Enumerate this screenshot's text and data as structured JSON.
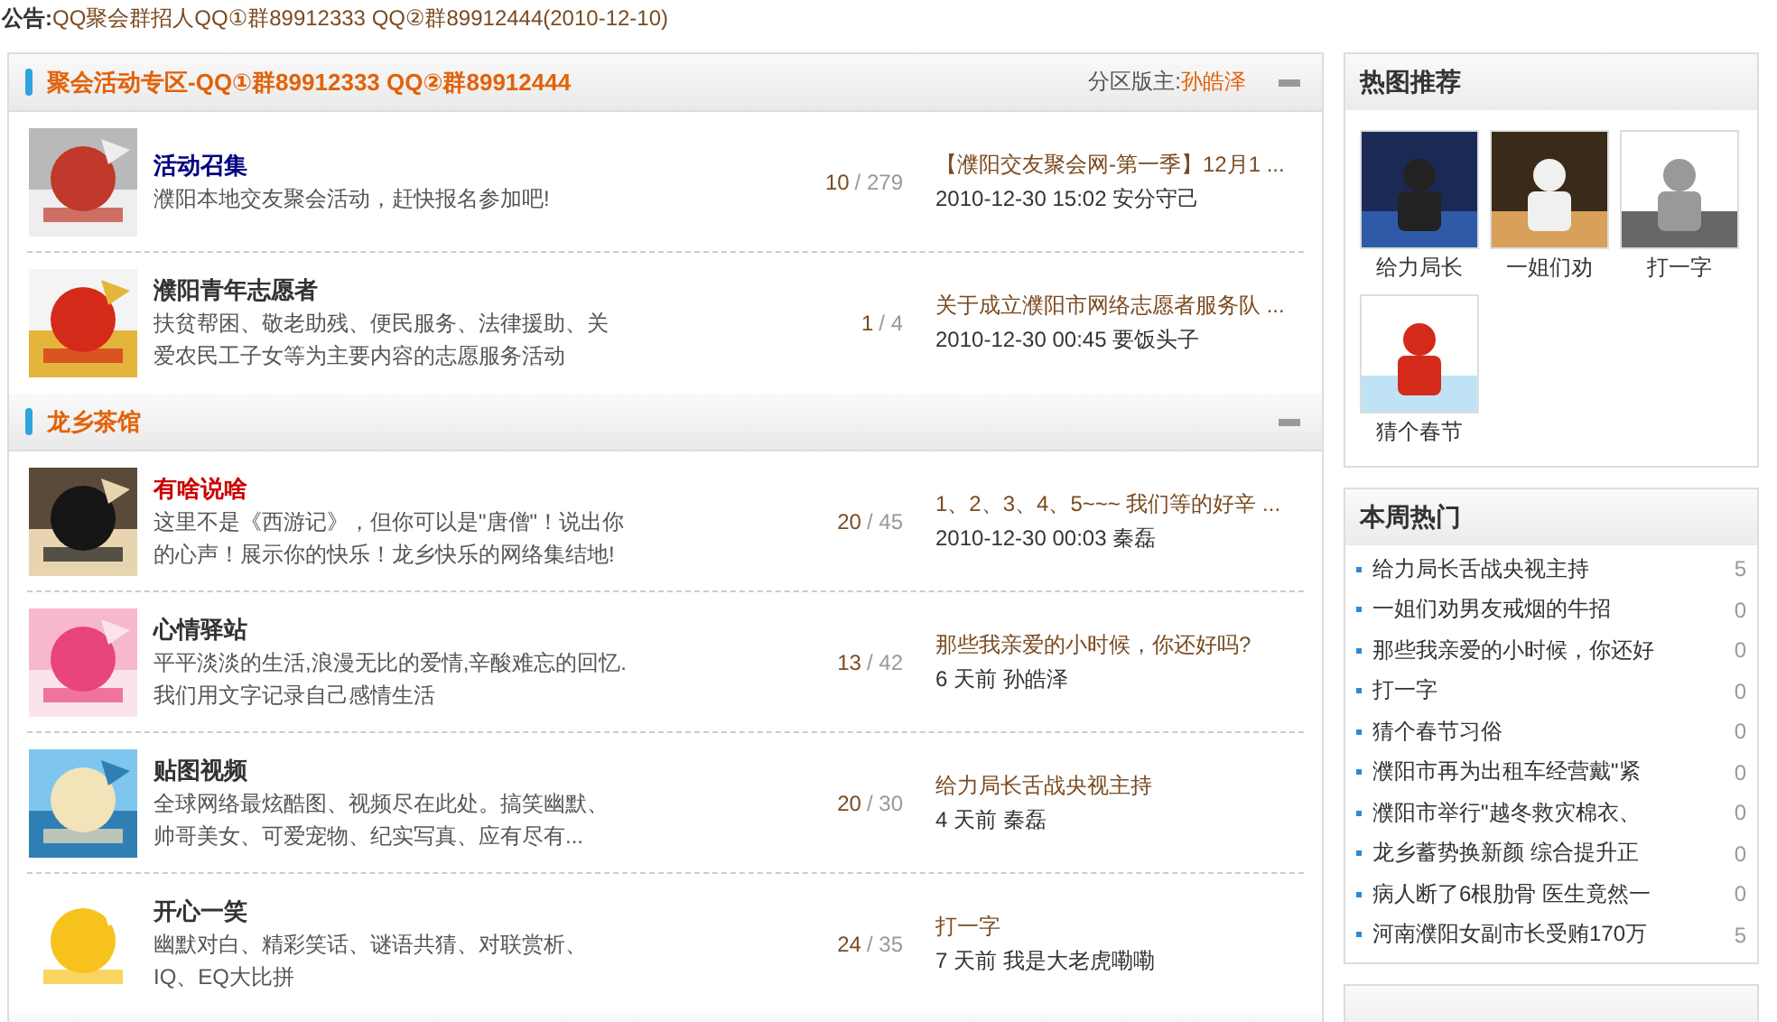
{
  "announcement": {
    "label": "公告:",
    "text": "QQ聚会群招人QQ①群89912333 QQ②群89912444(2010-12-10)"
  },
  "sections": [
    {
      "title": "聚会活动专区-QQ①群89912333 QQ②群89912444",
      "moderator_label": "分区版主:",
      "moderator": "孙皓泽",
      "forums": [
        {
          "name": "活动召集",
          "color": "#000080",
          "description": "濮阳本地交友聚会活动，赶快报名参加吧!",
          "topics": "10",
          "posts": "/ 279",
          "last_title": "【濮阳交友聚会网-第一季】12月1 ...",
          "last_meta": "2010-12-30 15:02 安分守己"
        },
        {
          "name": "濮阳青年志愿者",
          "color": "#333333",
          "description": "扶贫帮困、敬老助残、便民服务、法律援助、关爱农民工子女等为主要内容的志愿服务活动",
          "topics": "1",
          "posts": "/ 4",
          "last_title": "关于成立濮阳市网络志愿者服务队 ...",
          "last_meta": "2010-12-30 00:45 要饭头子"
        }
      ]
    },
    {
      "title": "龙乡茶馆",
      "forums": [
        {
          "name": "有啥说啥",
          "color": "#cc0000",
          "description": "这里不是《西游记》，但你可以是\"唐僧\"！说出你的心声！展示你的快乐！龙乡快乐的网络集结地!",
          "topics": "20",
          "posts": "/ 45",
          "last_title": "1、2、3、4、5~~~ 我们等的好辛 ...",
          "last_meta": "2010-12-30 00:03 秦磊"
        },
        {
          "name": "心情驿站",
          "color": "#333333",
          "description": "平平淡淡的生活,浪漫无比的爱情,辛酸难忘的回忆.我们用文字记录自己感情生活",
          "topics": "13",
          "posts": "/ 42",
          "last_title": "那些我亲爱的小时候，你还好吗?",
          "last_meta": "6 天前 孙皓泽"
        },
        {
          "name": "贴图视频",
          "color": "#333333",
          "description": "全球网络最炫酷图、视频尽在此处。搞笑幽默、帅哥美女、可爱宠物、纪实写真、应有尽有...",
          "topics": "20",
          "posts": "/ 30",
          "last_title": "给力局长舌战央视主持",
          "last_meta": "4 天前 秦磊"
        },
        {
          "name": "开心一笑",
          "color": "#333333",
          "description": "幽默对白、精彩笑话、谜语共猜、对联赏析、IQ、EQ大比拼",
          "topics": "24",
          "posts": "/ 35",
          "last_title": "打一字",
          "last_meta": "7 天前 我是大老虎嘞嘞"
        }
      ]
    }
  ],
  "hot_pictures": {
    "title": "热图推荐",
    "items": [
      {
        "caption": "给力局长"
      },
      {
        "caption": "一姐们劝"
      },
      {
        "caption": "打一字"
      },
      {
        "caption": "猜个春节"
      }
    ]
  },
  "weekly_hot": {
    "title": "本周热门",
    "items": [
      {
        "text": "给力局长舌战央视主持",
        "count": "5"
      },
      {
        "text": "一姐们劝男友戒烟的牛招",
        "count": "0"
      },
      {
        "text": "那些我亲爱的小时候，你还好",
        "count": "0"
      },
      {
        "text": "打一字",
        "count": "0"
      },
      {
        "text": "猜个春节习俗",
        "count": "0"
      },
      {
        "text": "濮阳市再为出租车经营戴\"紧",
        "count": "0"
      },
      {
        "text": "濮阳市举行\"越冬救灾棉衣、",
        "count": "0"
      },
      {
        "text": "龙乡蓄势换新颜 综合提升正",
        "count": "0"
      },
      {
        "text": "病人断了6根肋骨 医生竟然一",
        "count": "0"
      },
      {
        "text": "河南濮阳女副市长受贿170万",
        "count": "5"
      }
    ]
  }
}
